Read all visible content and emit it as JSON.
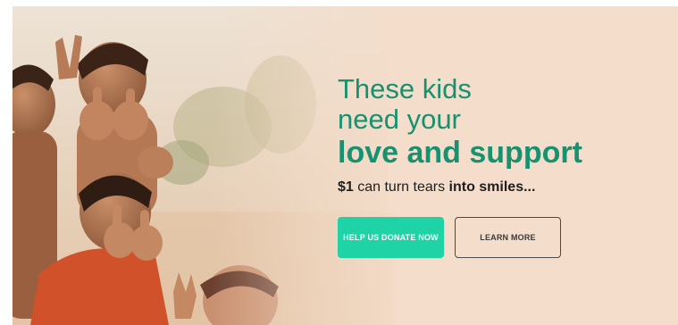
{
  "hero": {
    "headline_line1": "These kids",
    "headline_line2": "need your",
    "headline_line3": "love and support",
    "tagline_bold_prefix": "$1",
    "tagline_middle": " can turn tears ",
    "tagline_bold_suffix": "into smiles...",
    "donate_label": "HELP US DONATE NOW",
    "learn_label": "LEARN MORE",
    "image_subject": "children-giving-thumbs-up-photo"
  },
  "colors": {
    "headline_green": "#17916f",
    "donate_button": "#1fd3a6",
    "background_peach": "#f4ddca",
    "text_dark": "#1e1e1e"
  }
}
